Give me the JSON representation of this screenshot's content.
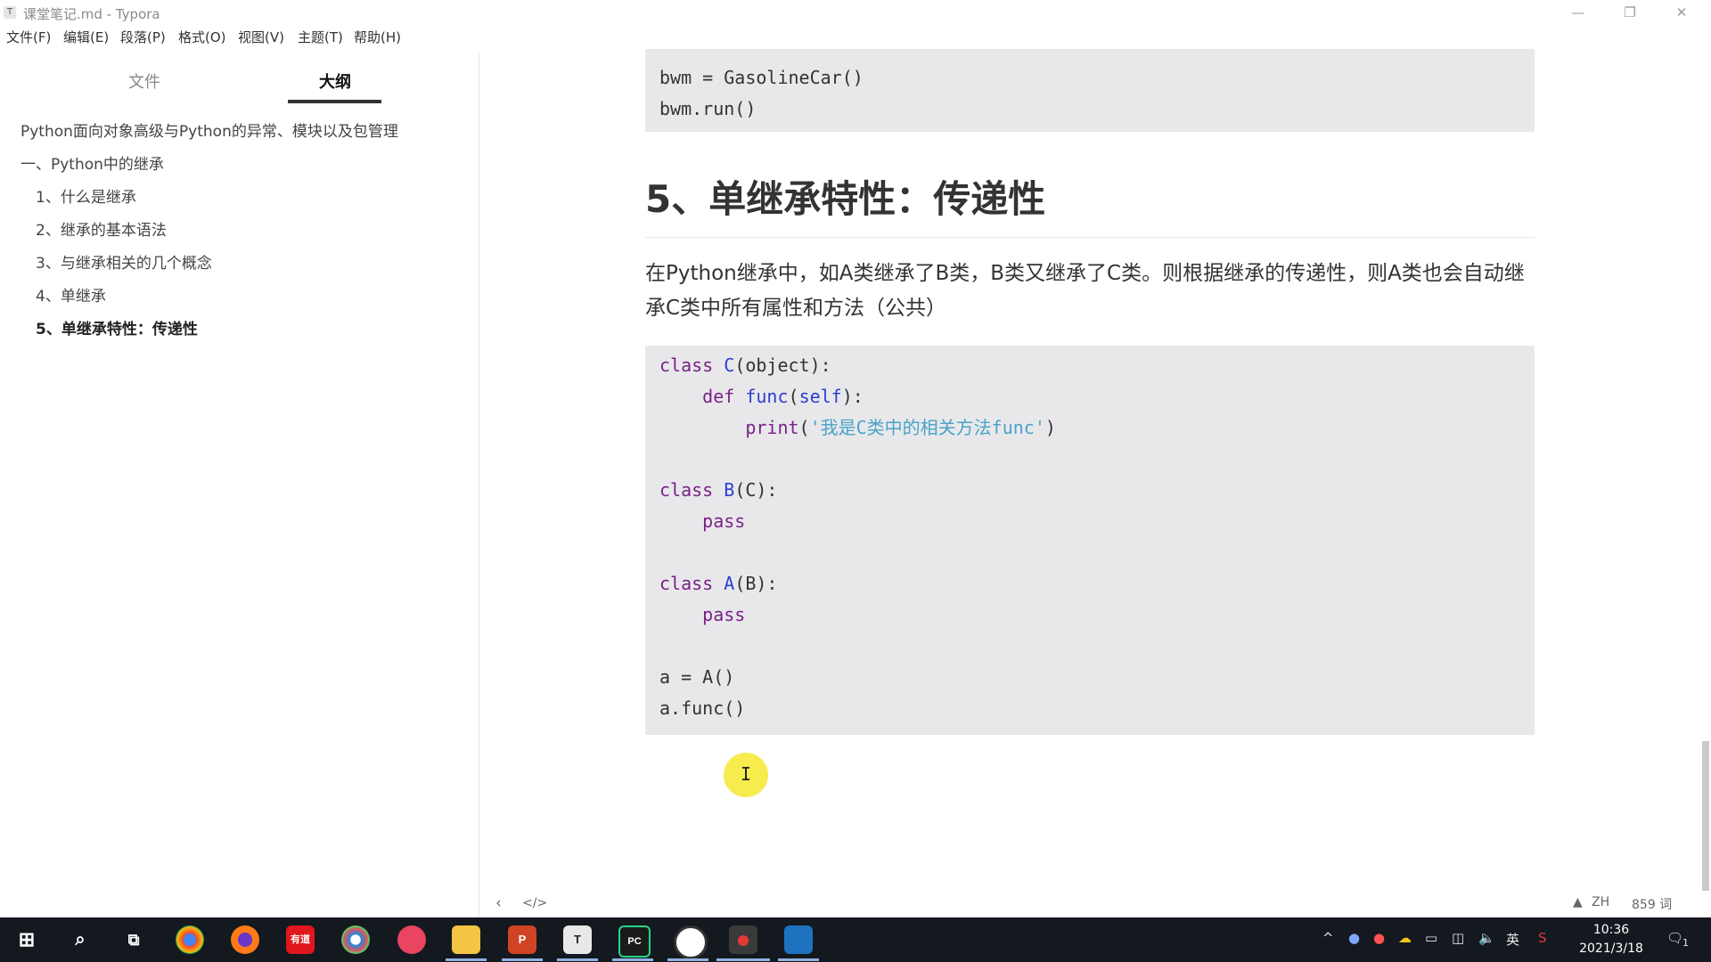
{
  "window": {
    "title": "课堂笔记.md - Typora",
    "app_icon": "T"
  },
  "menu": [
    "文件(F)",
    "编辑(E)",
    "段落(P)",
    "格式(O)",
    "视图(V)",
    "主题(T)",
    "帮助(H)"
  ],
  "sidebar": {
    "tabs": [
      {
        "label": "文件"
      },
      {
        "label": "大纲",
        "active": true
      }
    ],
    "outline": [
      {
        "label": "Python面向对象高级与Python的异常、模块以及包管理",
        "level": 1
      },
      {
        "label": "一、Python中的继承",
        "level": 1
      },
      {
        "label": "1、什么是继承",
        "level": 2
      },
      {
        "label": "2、继承的基本语法",
        "level": 2
      },
      {
        "label": "3、与继承相关的几个概念",
        "level": 2
      },
      {
        "label": "4、单继承",
        "level": 2
      },
      {
        "label": "5、单继承特性：传递性",
        "level": 2,
        "active": true
      }
    ]
  },
  "editor": {
    "code_top_lines": [
      "bwm = GasolineCar()",
      "bwm.run()"
    ],
    "heading": "5、单继承特性：传递性",
    "paragraph": "在Python继承中，如A类继承了B类，B类又继承了C类。则根据继承的传递性，则A类也会自动继承C类中所有属性和方法（公共）",
    "code_main_lines": [
      "class C(object):",
      "    def func(self):",
      "        print('我是C类中的相关方法func')",
      "",
      "class B(C):",
      "    pass",
      "",
      "class A(B):",
      "    pass",
      "",
      "a = A()",
      "a.func()"
    ],
    "cursor_glyph": "I"
  },
  "statusbar": {
    "lang": "ZH",
    "word_count": "859 词"
  },
  "taskbar": {
    "apps": [
      "start-icon",
      "search-icon",
      "task-view-icon",
      "chrome-icon",
      "firefox-icon",
      "youdao-icon",
      "chromium-icon",
      "screen-recorder-icon",
      "file-explorer-icon",
      "powerpoint-icon",
      "typora-icon",
      "pycharm-icon",
      "obs-icon",
      "recorder-icon",
      "vscode-icon"
    ],
    "labels": {
      "youdao": "有道",
      "ppt": "P",
      "typora": "T",
      "pycharm": "PC"
    },
    "tray_ime": "英",
    "time": "10:36",
    "date": "2021/3/18",
    "notification_count": "1"
  }
}
